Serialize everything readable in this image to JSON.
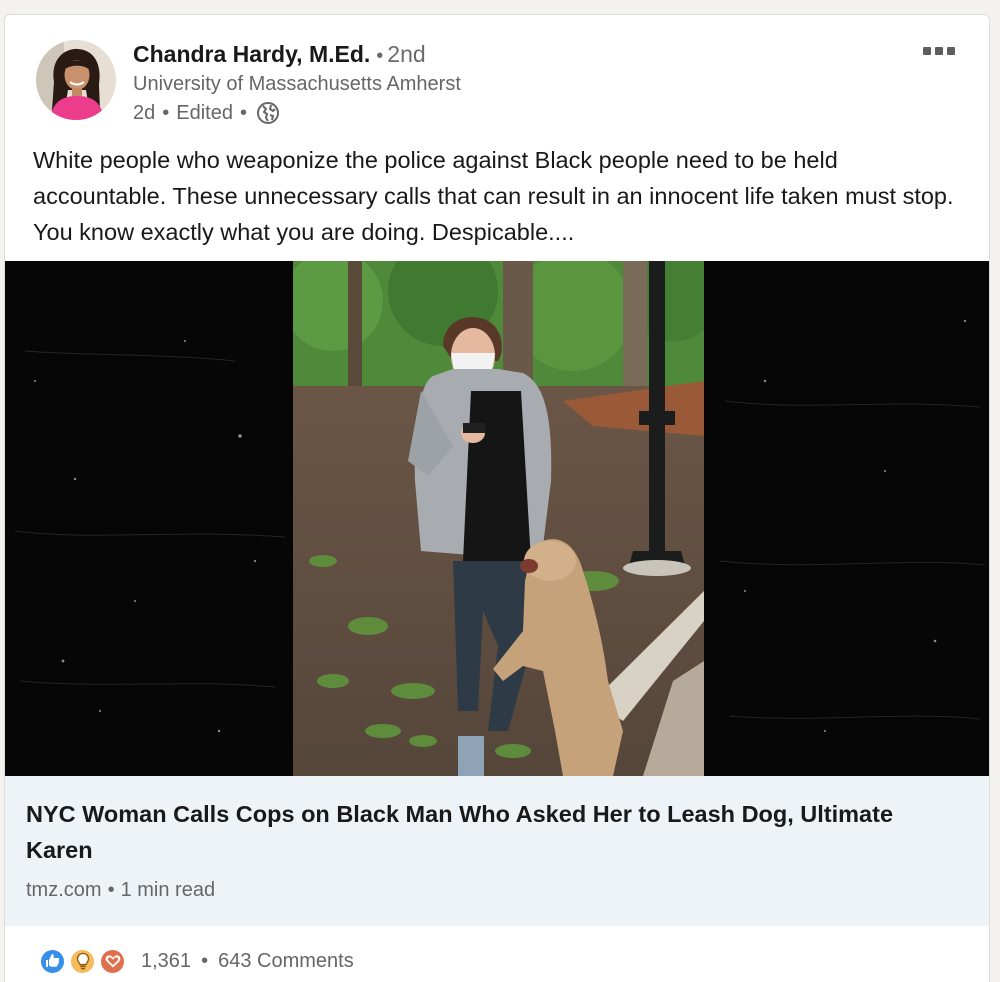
{
  "author": {
    "name": "Chandra Hardy, M.Ed.",
    "degree": "2nd",
    "headline": "University of Massachusetts Amherst",
    "time": "2d",
    "edited": "Edited"
  },
  "post": {
    "text": "White people who weaponize the police against Black people need to be held accountable. These unnecessary calls that can result in an innocent life taken must stop. You know exactly what you are doing. Despicable...."
  },
  "link": {
    "title": "NYC Woman Calls Cops on Black Man Who Asked Her to Leash Dog, Ultimate Karen",
    "source": "tmz.com",
    "read_time": "1 min read"
  },
  "social": {
    "reactions_count": "1,361",
    "comments": "643 Comments",
    "reaction_icons": [
      "like-icon",
      "insightful-icon",
      "love-icon"
    ]
  },
  "colors": {
    "like": "#378fe9",
    "insightful": "#f5bb5c",
    "love": "#df704d",
    "link_background": "#eef3f8"
  }
}
